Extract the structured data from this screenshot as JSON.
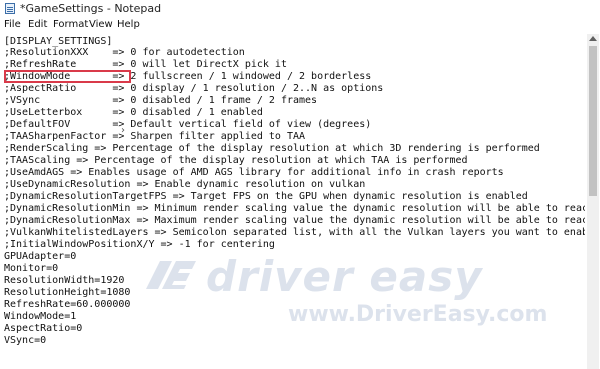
{
  "window": {
    "title": "*GameSettings - Notepad"
  },
  "menu": {
    "file": "File",
    "edit": "Edit",
    "format": "Format",
    "view": "View",
    "help": "Help"
  },
  "editor": {
    "lines": [
      "[DISPLAY_SETTINGS]",
      ";ResolutionXXX    => 0 for autodetection",
      ";RefreshRate      => 0 will let DirectX pick it",
      ";WindowMode       => 2 fullscreen / 1 windowed / 2 borderless",
      ";AspectRatio      => 0 display / 1 resolution / 2..N as options",
      ";VSync            => 0 disabled / 1 frame / 2 frames",
      ";UseLetterbox     => 0 disabled / 1 enabled",
      ";DefaultFOV       => Default vertical field of view (degrees)",
      ";TAASharpenFactor => Sharpen filter applied to TAA",
      ";RenderScaling => Percentage of the display resolution at which 3D rendering is performed",
      ";TAAScaling => Percentage of the display resolution at which TAA is performed",
      ";UseAmdAGS => Enables usage of AMD AGS library for additional info in crash reports",
      ";UseDynamicResolution => Enable dynamic resolution on vulkan",
      ";DynamicResolutionTargetFPS => Target FPS on the GPU when dynamic resolution is enabled",
      ";DynamicResolutionMin => Minimum render scaling value the dynamic resolution will be able to reach",
      ";DynamicResolutionMax => Maximum render scaling value the dynamic resolution will be able to reach",
      ";VulkanWhitelistedLayers => Semicolon separated list, with all the Vulkan layers you want to enable, l",
      ";InitialWindowPositionX/Y => -1 for centering",
      "GPUAdapter=0",
      "Monitor=0",
      "ResolutionWidth=1920",
      "ResolutionHeight=1080",
      "RefreshRate=60.000000",
      "WindowMode=1",
      "AspectRatio=0",
      "VSync=0"
    ]
  },
  "watermark": {
    "brand": "driver easy",
    "url": "www.DriverEasy.com",
    "color": "#8296b9"
  },
  "annotation": {
    "color": "#d93a4a"
  }
}
